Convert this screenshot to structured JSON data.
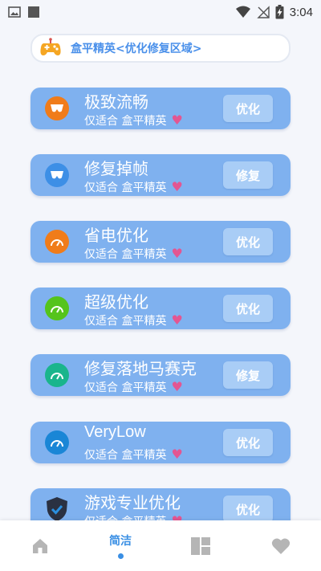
{
  "status_bar": {
    "time": "3:04"
  },
  "header": {
    "title": "盒平精英<优化修复区域>",
    "icon": "gamepad-icon"
  },
  "cards": [
    {
      "title": "极致流畅",
      "subtitle": "仅适合 盒平精英",
      "heart": "♥",
      "button": "优化",
      "icon": "mask-icon",
      "icon_color": "#f07c1a"
    },
    {
      "title": "修复掉帧",
      "subtitle": "仅适合 盒平精英",
      "heart": "♥",
      "button": "修复",
      "icon": "mask-icon",
      "icon_color": "#3d8fe6"
    },
    {
      "title": "省电优化",
      "subtitle": "仅适合 盒平精英",
      "heart": "♥",
      "button": "优化",
      "icon": "speedometer-icon",
      "icon_color": "#f07c1a"
    },
    {
      "title": "超级优化",
      "subtitle": "仅适合 盒平精英",
      "heart": "♥",
      "button": "优化",
      "icon": "speedometer-icon",
      "icon_color": "#55c41c"
    },
    {
      "title": "修复落地马赛克",
      "subtitle": "仅适合 盒平精英",
      "heart": "♥",
      "button": "修复",
      "icon": "speedometer-icon",
      "icon_color": "#1ab58c"
    },
    {
      "title": "VeryLow",
      "subtitle": "仅适合 盒平精英",
      "heart": "♥",
      "button": "优化",
      "icon": "speedometer-icon",
      "icon_color": "#1a86d6"
    },
    {
      "title": "游戏专业优化",
      "subtitle": "仅适合 盒平精英",
      "heart": "♥",
      "button": "优化",
      "icon": "shield-check-icon",
      "icon_color": "#2a3142"
    }
  ],
  "nav": {
    "items": [
      {
        "icon": "home-icon"
      },
      {
        "label": "简洁"
      },
      {
        "icon": "dashboard-icon"
      },
      {
        "icon": "heart-icon"
      }
    ],
    "active_color": "#3a8fe4"
  }
}
